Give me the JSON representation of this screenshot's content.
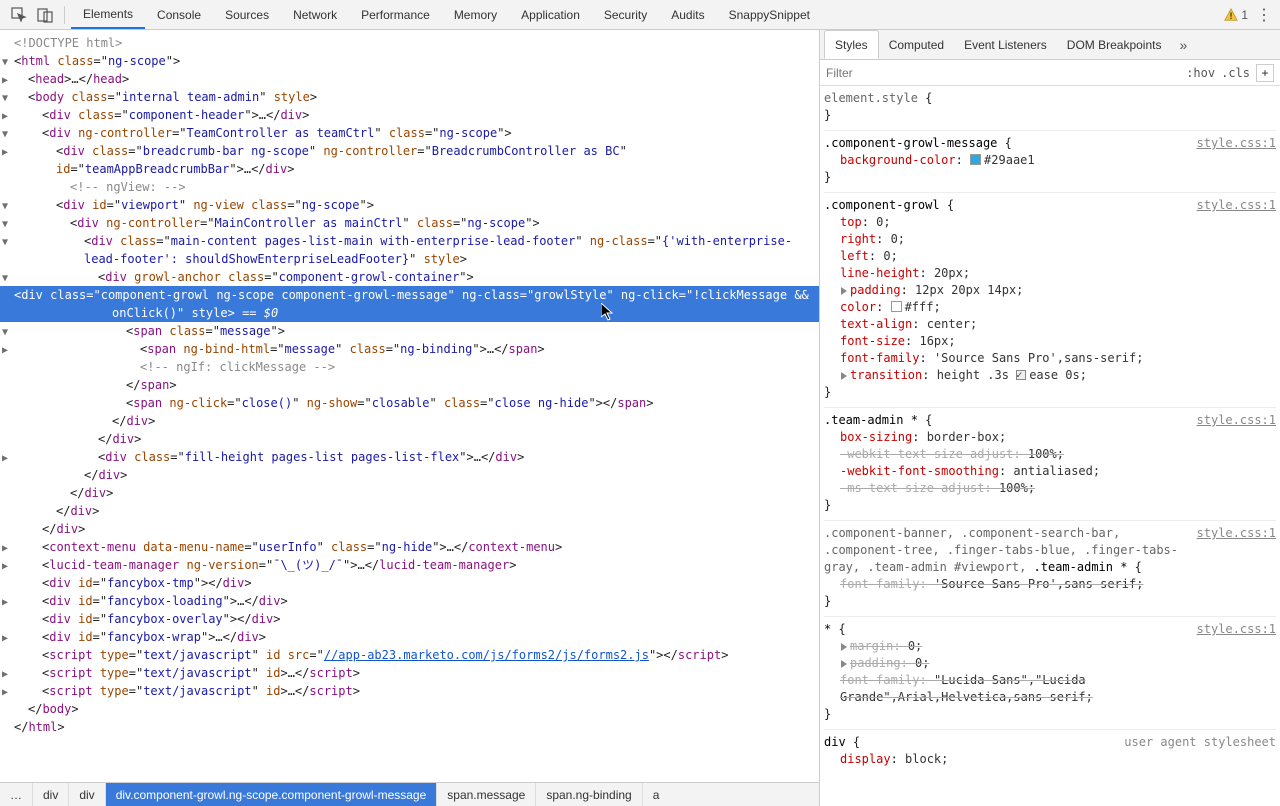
{
  "toolbar": {
    "tabs": [
      "Elements",
      "Console",
      "Sources",
      "Network",
      "Performance",
      "Memory",
      "Application",
      "Security",
      "Audits",
      "SnappySnippet"
    ],
    "active_tab": "Elements",
    "warnings": "1"
  },
  "dom": {
    "doctype": "<!DOCTYPE html>",
    "html_open_class": "ng-scope",
    "head": {
      "collapsed_text": "…"
    },
    "body_class": "internal team-admin",
    "body_style_attr": "style",
    "component_header_class": "component-header",
    "team_controller": "TeamController as teamCtrl",
    "team_controller_class": "ng-scope",
    "breadcrumb_class": "breadcrumb-bar ng-scope",
    "breadcrumb_ctrl": "BreadcrumbController as BC",
    "breadcrumb_id": "teamAppBreadcrumbBar",
    "ngview_comment": "<!-- ngView:  -->",
    "viewport_id": "viewport",
    "viewport_attr": "ng-view",
    "viewport_class": "ng-scope",
    "main_controller": "MainController as mainCtrl",
    "main_controller_class": "ng-scope",
    "main_content_class": "main-content pages-list-main with-enterprise-lead-footer",
    "main_content_ngclass": "{'with-enterprise-lead-footer': shouldShowEnterpriseLeadFooter}",
    "growl_anchor_attr": "growl-anchor",
    "growl_anchor_class": "component-growl-container",
    "selected": {
      "class": "component-growl ng-scope component-growl-message",
      "ngclass": "growlStyle",
      "ngclick": "!clickMessage && onClick()",
      "style_attr": "style",
      "eq0": "== $0"
    },
    "message_span_class": "message",
    "ngbind": "message",
    "ngbind_class": "ng-binding",
    "ngif_comment": "<!-- ngIf: clickMessage -->",
    "close_ngclick": "close()",
    "close_ngshow": "closable",
    "close_class": "close ng-hide",
    "fill_height_class": "fill-height pages-list pages-list-flex",
    "context_menu_name": "userInfo",
    "context_menu_class": "ng-hide",
    "lucid_ngversion": "¯\\_(ツ)_/¯",
    "fancybox_tmp": "fancybox-tmp",
    "fancybox_loading": "fancybox-loading",
    "fancybox_overlay": "fancybox-overlay",
    "fancybox_wrap": "fancybox-wrap",
    "script_type": "text/javascript",
    "script_src": "//app-ab23.marketo.com/js/forms2/js/forms2.js"
  },
  "crumbs": [
    "…",
    "div",
    "div",
    "div.component-growl.ng-scope.component-growl-message",
    "span.message",
    "span.ng-binding",
    "a"
  ],
  "crumbs_active_index": 3,
  "right": {
    "tabs": [
      "Styles",
      "Computed",
      "Event Listeners",
      "DOM Breakpoints"
    ],
    "active_tab": "Styles",
    "filter_placeholder": "Filter",
    "hov": ":hov",
    "cls": ".cls",
    "element_style_selector": "element.style",
    "rules": [
      {
        "selector": ".component-growl-message",
        "src": "style.css:1",
        "decls": [
          {
            "prop": "background-color",
            "val": "#29aae1",
            "swatch": "#29aae1",
            "end": ";"
          }
        ]
      },
      {
        "selector": ".component-growl",
        "src": "style.css:1",
        "decls": [
          {
            "prop": "top",
            "val": "0;"
          },
          {
            "prop": "right",
            "val": "0;"
          },
          {
            "prop": "left",
            "val": "0;"
          },
          {
            "prop": "line-height",
            "val": "20px;"
          },
          {
            "prop": "padding",
            "val": "12px 20px 14px;",
            "tri": true
          },
          {
            "prop": "color",
            "val": "#fff;",
            "swatch": "#fff"
          },
          {
            "prop": "text-align",
            "val": "center;"
          },
          {
            "prop": "font-size",
            "val": "16px;"
          },
          {
            "prop": "font-family",
            "val": "'Source Sans Pro',sans-serif;"
          },
          {
            "prop": "transition",
            "val": "height .3s ",
            "tri": true,
            "tail_chk": true,
            "tail": "ease 0s;"
          }
        ]
      },
      {
        "selector": ".team-admin *",
        "src": "style.css:1",
        "decls": [
          {
            "prop": "box-sizing",
            "val": "border-box;"
          },
          {
            "prop": "-webkit-text-size-adjust",
            "val": "100%;",
            "struck": true
          },
          {
            "prop": "-webkit-font-smoothing",
            "val": "antialiased;"
          },
          {
            "prop": "-ms-text-size-adjust",
            "val": "100%;",
            "struck": true
          }
        ]
      },
      {
        "selector_multi": ".component-banner, .component-search-bar, .component-tree, .finger-tabs-blue, .finger-tabs-gray, .team-admin #viewport, ",
        "selector_strong": ".team-admin *",
        "src": "style.css:1",
        "decls": [
          {
            "prop": "font-family",
            "val": "'Source Sans Pro',sans-serif;",
            "struck": true
          }
        ]
      },
      {
        "selector": "*",
        "src": "style.css:1",
        "decls": [
          {
            "prop": "margin",
            "val": "0;",
            "tri": true,
            "struck": true
          },
          {
            "prop": "padding",
            "val": "0;",
            "tri": true,
            "struck": true
          },
          {
            "prop": "font-family",
            "val": "\"Lucida Sans\",\"Lucida Grande\",Arial,Helvetica,sans-serif;",
            "struck": true
          }
        ]
      },
      {
        "selector": "div",
        "src": "user agent stylesheet",
        "no_underline": true,
        "decls": [
          {
            "prop": "display",
            "val": "block;"
          }
        ],
        "open_only": true
      }
    ]
  }
}
